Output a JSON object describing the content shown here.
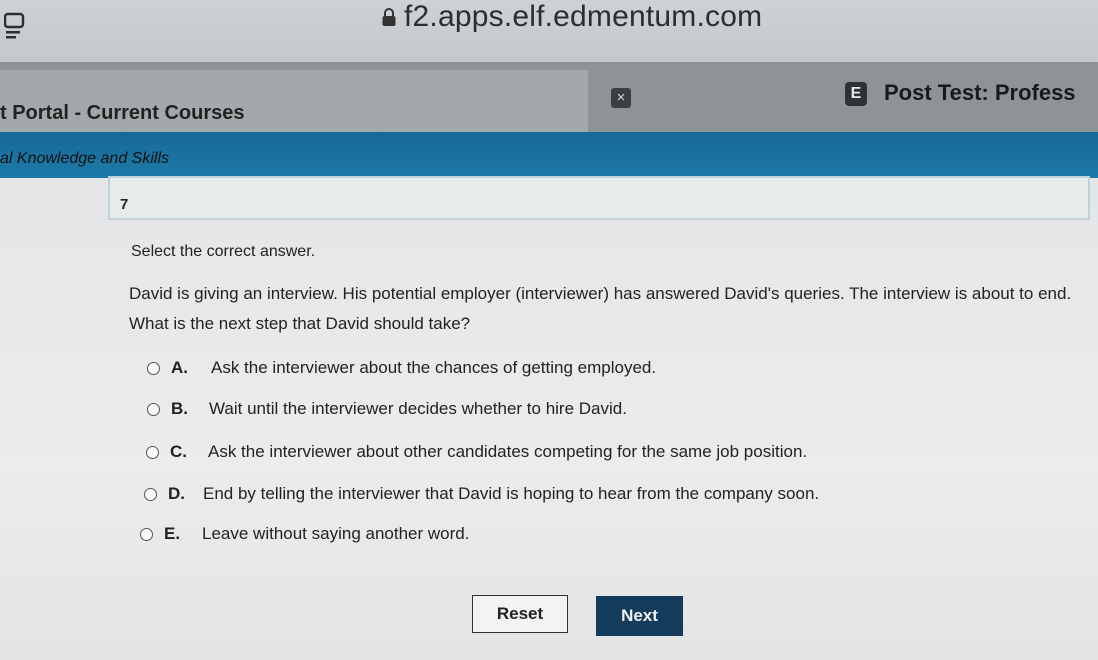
{
  "browser": {
    "url": "f2.apps.elf.edmentum.com",
    "icons": [
      "tabs-icon",
      "lock-icon",
      "close-icon",
      "edmentum-e-icon"
    ]
  },
  "tabs": {
    "left_title": "t Portal - Current Courses",
    "close_label": "×",
    "right_icon_letter": "E",
    "right_title": "Post Test: Profess"
  },
  "course": {
    "title": "al Knowledge and Skills",
    "accent_color": "#1e79a8"
  },
  "question": {
    "number": "7",
    "instruction": "Select the correct answer.",
    "text": "David is giving an interview. His potential employer (interviewer) has answered David's queries. The interview is about to end. What is the next step that David should take?",
    "options": [
      {
        "letter": "A.",
        "text": "Ask the interviewer about the chances of getting employed."
      },
      {
        "letter": "B.",
        "text": "Wait until the interviewer decides whether to hire David."
      },
      {
        "letter": "C.",
        "text": "Ask the interviewer about other candidates competing for the same job position."
      },
      {
        "letter": "D.",
        "text": "End by telling the interviewer that David is hoping to hear from the company soon."
      },
      {
        "letter": "E.",
        "text": "Leave without saying another word."
      }
    ]
  },
  "buttons": {
    "reset_label": "Reset",
    "next_label": "Next",
    "next_color": "#143c5a"
  }
}
